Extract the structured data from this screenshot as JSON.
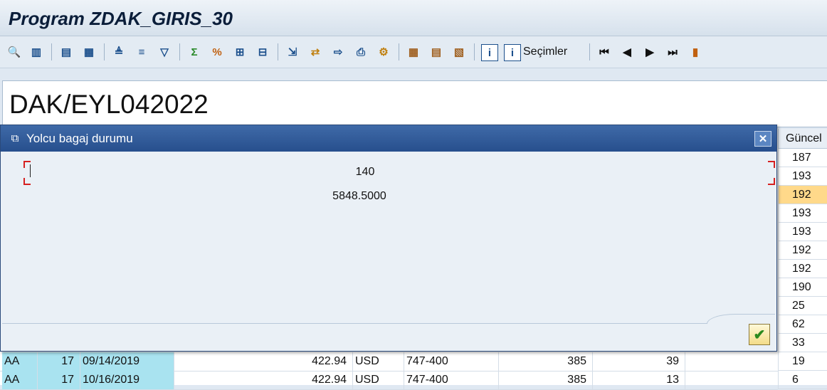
{
  "window": {
    "title": "Program ZDAK_GIRIS_30"
  },
  "toolbar": {
    "selections_label": "Seçimler",
    "icons": [
      "detail-icon",
      "column-layout-icon",
      "select-all-icon",
      "deselect-all-icon",
      "sort-ascending-icon",
      "sort-descending-icon",
      "filter-icon",
      "sum-icon",
      "subtotal-icon",
      "insert-row-icon",
      "delete-row-icon",
      "export-icon",
      "transfer-icon",
      "move-icon",
      "print-icon",
      "view-icon",
      "grid-icon",
      "change-layout-icon",
      "save-layout-icon",
      "info-icon",
      "info-selections-icon",
      "first-page-icon",
      "previous-page-icon",
      "next-page-icon",
      "last-page-icon",
      "graphic-icon"
    ]
  },
  "header": {
    "doc_title": "DAK/EYL042022"
  },
  "grid": {
    "column_header": "Güncel",
    "right_values": [
      "187",
      "193",
      "192",
      "193",
      "193",
      "192",
      "192",
      "190",
      "25",
      "62",
      "33",
      "19",
      "6"
    ],
    "rows": [
      {
        "carrier": "AA",
        "flight": "17",
        "date": "09/14/2019",
        "price": "422.94",
        "currency": "USD",
        "plane": "747-400",
        "seats_max": "385",
        "seats_occ": "39"
      },
      {
        "carrier": "AA",
        "flight": "17",
        "date": "10/16/2019",
        "price": "422.94",
        "currency": "USD",
        "plane": "747-400",
        "seats_max": "385",
        "seats_occ": "13"
      }
    ]
  },
  "dialog": {
    "title": "Yolcu bagaj durumu",
    "value_1": "140",
    "value_2": "5848.5000",
    "close_symbol": "✕",
    "ok_symbol": "✔"
  }
}
